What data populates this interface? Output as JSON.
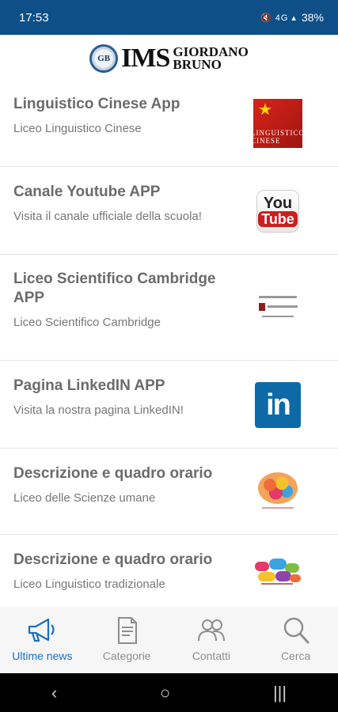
{
  "status_bar": {
    "time": "17:53",
    "icons": "🔇 4G ▴",
    "battery": "38%"
  },
  "header": {
    "logo_badge": "GB",
    "logo_ims": "IMS",
    "logo_name_line1": "GIORDANO",
    "logo_name_line2": "BRUNO"
  },
  "items": [
    {
      "title": "Linguistico Cinese App",
      "subtitle": "Liceo Linguistico Cinese",
      "thumb_text": "LINGUISTICO CINESE"
    },
    {
      "title": "Canale Youtube APP",
      "subtitle": "Visita il canale ufficiale della scuola!",
      "thumb_you": "You",
      "thumb_tube": "Tube"
    },
    {
      "title": "Liceo Scientifico Cambridge APP",
      "subtitle": "Liceo Scientifico Cambridge"
    },
    {
      "title": "Pagina LinkedIN APP",
      "subtitle": "Visita la nostra pagina LinkedIN!",
      "thumb_text": "in"
    },
    {
      "title": "Descrizione e quadro orario",
      "subtitle": "Liceo delle Scienze umane"
    },
    {
      "title": "Descrizione e quadro orario",
      "subtitle": "Liceo Linguistico tradizionale"
    }
  ],
  "bottom_nav": [
    {
      "label": "Ultime news",
      "icon": "megaphone-icon",
      "active": true
    },
    {
      "label": "Categorie",
      "icon": "document-icon",
      "active": false
    },
    {
      "label": "Contatti",
      "icon": "people-icon",
      "active": false
    },
    {
      "label": "Cerca",
      "icon": "search-icon",
      "active": false
    }
  ],
  "system_nav": {
    "back": "‹",
    "home": "○",
    "recents": "|||"
  },
  "colors": {
    "status_bar": "#0d4f86",
    "accent": "#1a6fbf",
    "inactive": "#8e8e8e"
  }
}
